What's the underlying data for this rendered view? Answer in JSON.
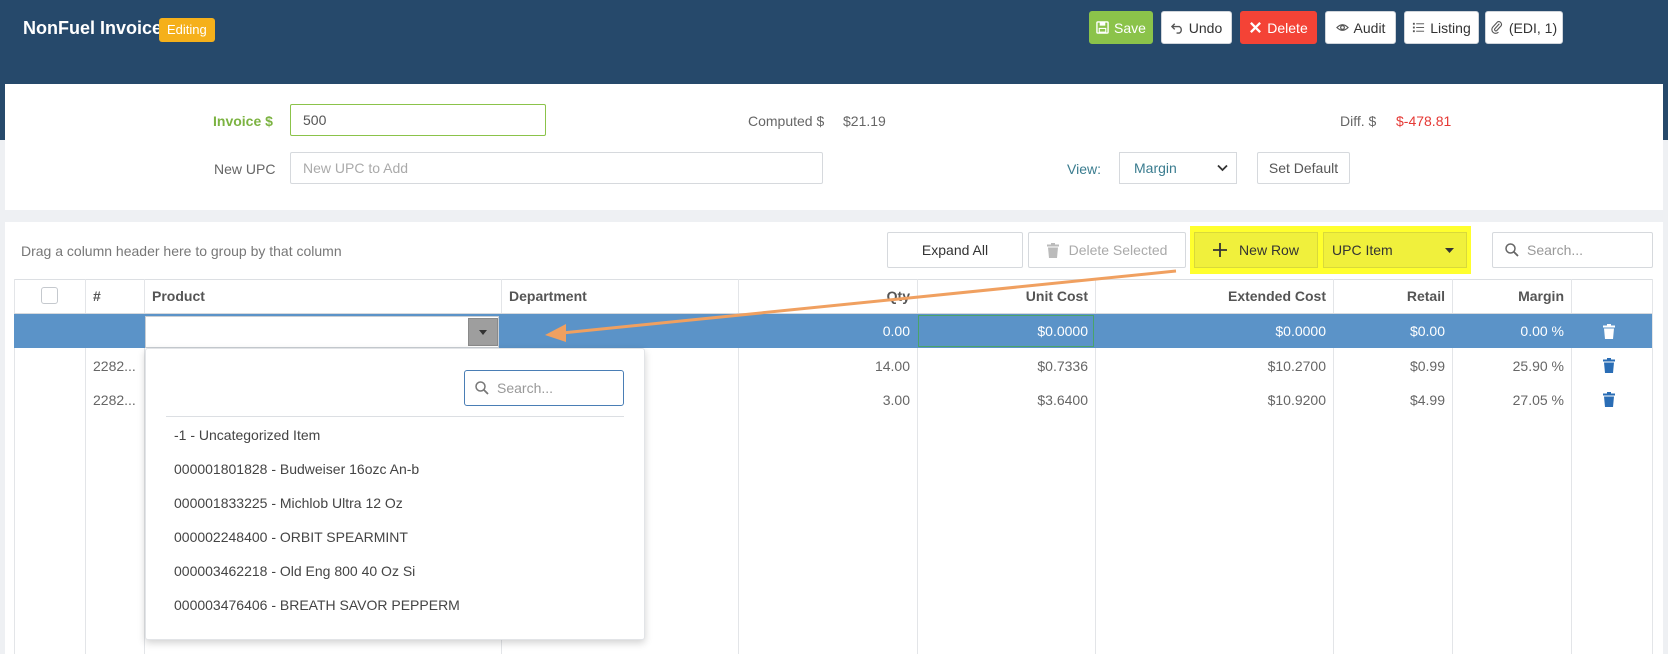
{
  "header": {
    "title": "NonFuel Invoice",
    "status_badge": "Editing",
    "buttons": {
      "save": "Save",
      "undo": "Undo",
      "delete": "Delete",
      "audit": "Audit",
      "listing": "Listing",
      "attachment": "(EDI, 1)"
    }
  },
  "summary": {
    "invoice_label": "Invoice $",
    "invoice_value": "500",
    "computed_label": "Computed $",
    "computed_value": "$21.19",
    "diff_label": "Diff. $",
    "diff_value": "$-478.81",
    "new_upc_label": "New UPC",
    "new_upc_placeholder": "New UPC to Add",
    "view_label": "View:",
    "view_selected": "Margin",
    "set_default": "Set Default"
  },
  "toolbar": {
    "group_hint": "Drag a column header here to group by that column",
    "expand_all": "Expand All",
    "delete_selected": "Delete Selected",
    "new_row": "New Row",
    "row_type_selected": "UPC Item",
    "search_placeholder": "Search..."
  },
  "grid": {
    "columns": {
      "num": "#",
      "product": "Product",
      "department": "Department",
      "qty": "Qty",
      "unit_cost": "Unit Cost",
      "extended_cost": "Extended Cost",
      "retail": "Retail",
      "margin": "Margin"
    },
    "rows": [
      {
        "num": "",
        "qty": "0.00",
        "unit_cost": "$0.0000",
        "extended_cost": "$0.0000",
        "retail": "$0.00",
        "margin": "0.00 %"
      },
      {
        "num": "2282...",
        "qty": "14.00",
        "unit_cost": "$0.7336",
        "extended_cost": "$10.2700",
        "retail": "$0.99",
        "margin": "25.90 %"
      },
      {
        "num": "2282...",
        "qty": "3.00",
        "unit_cost": "$3.6400",
        "extended_cost": "$10.9200",
        "retail": "$4.99",
        "margin": "27.05 %"
      }
    ]
  },
  "product_dropdown": {
    "search_placeholder": "Search...",
    "items": [
      "-1 - Uncategorized Item",
      "000001801828 - Budweiser 16ozc An-b",
      "000001833225 - Michlob Ultra 12 Oz",
      "000002248400 - ORBIT SPEARMINT",
      "000003462218 - Old Eng 800 40 Oz Si",
      "000003476406 - BREATH SAVOR PEPPERM"
    ]
  },
  "colors": {
    "header_bg": "#26496b",
    "badge": "#f5b01a",
    "save": "#8bc34a",
    "delete": "#f44336",
    "selected_row": "#5b93c8",
    "highlight": "#ffff2e",
    "annotation_arrow": "#f0a060",
    "diff_negative": "#e53935"
  },
  "icons": [
    "save-icon",
    "undo-icon",
    "close-icon",
    "eye-icon",
    "list-icon",
    "paperclip-icon",
    "trash-icon",
    "plus-icon",
    "caret-down-icon",
    "search-icon"
  ]
}
